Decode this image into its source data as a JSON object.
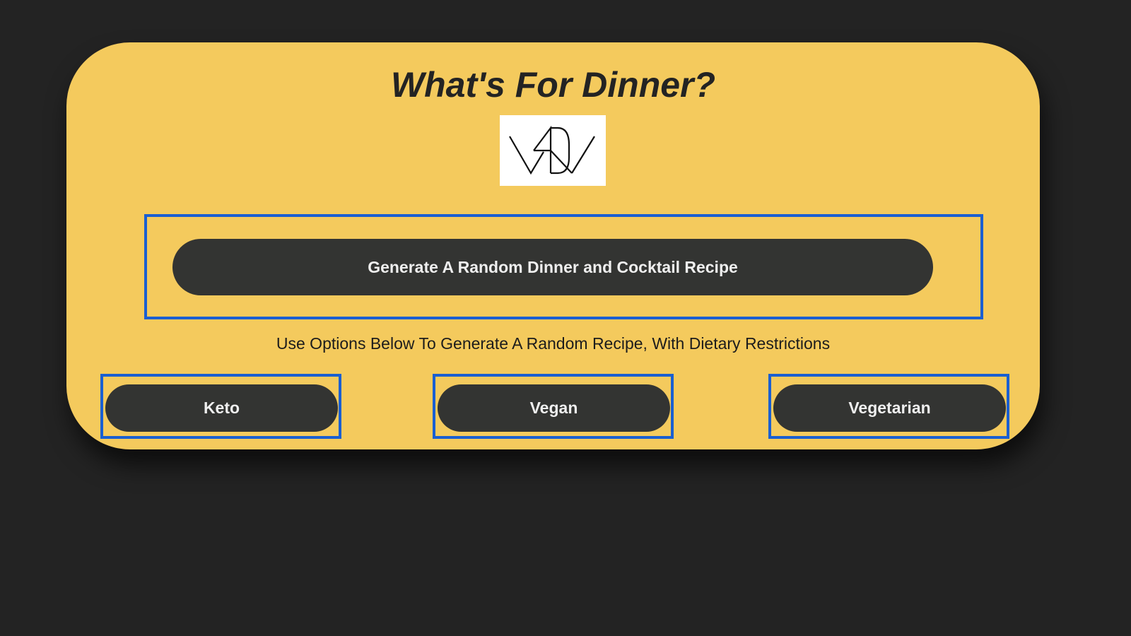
{
  "page": {
    "title": "What's For Dinner?",
    "logo_icon": "wdd-logo-icon"
  },
  "main_action": {
    "label": "Generate A Random Dinner and Cocktail Recipe"
  },
  "subtitle": "Use Options Below To Generate A Random Recipe, With Dietary Restrictions",
  "options": [
    {
      "label": "Keto"
    },
    {
      "label": "Vegan"
    },
    {
      "label": "Vegetarian"
    }
  ],
  "colors": {
    "background": "#232323",
    "card": "#f4ca5d",
    "button": "#333432",
    "button_text": "#efefef",
    "highlight_border": "#1a5fd1"
  }
}
